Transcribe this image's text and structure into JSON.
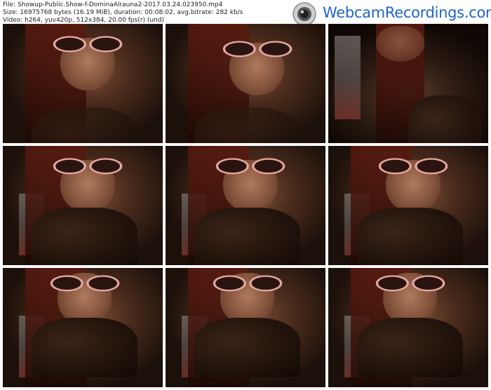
{
  "header": {
    "file_line": "File: Showup-Public.Show-f-DominaAlrauna2-2017.03.24.023950.mp4",
    "size_line": "Size: 16975768 bytes (16.19 MiB), duration: 00:08:02, avg.bitrate: 282 kb/s",
    "video_line": "Video: h264, yuv420p, 512x384, 20.00 fps(r) (und)"
  },
  "logo": {
    "text": "WebcamRecordings.com",
    "icon": "webcam-icon",
    "colors": {
      "text": "#1e63c8",
      "camera": "#8a8a8a"
    }
  },
  "thumbnails": [
    {
      "label": "frame-1"
    },
    {
      "label": "frame-2"
    },
    {
      "label": "frame-3"
    },
    {
      "label": "frame-4"
    },
    {
      "label": "frame-5"
    },
    {
      "label": "frame-6"
    },
    {
      "label": "frame-7"
    },
    {
      "label": "frame-8"
    },
    {
      "label": "frame-9"
    }
  ]
}
